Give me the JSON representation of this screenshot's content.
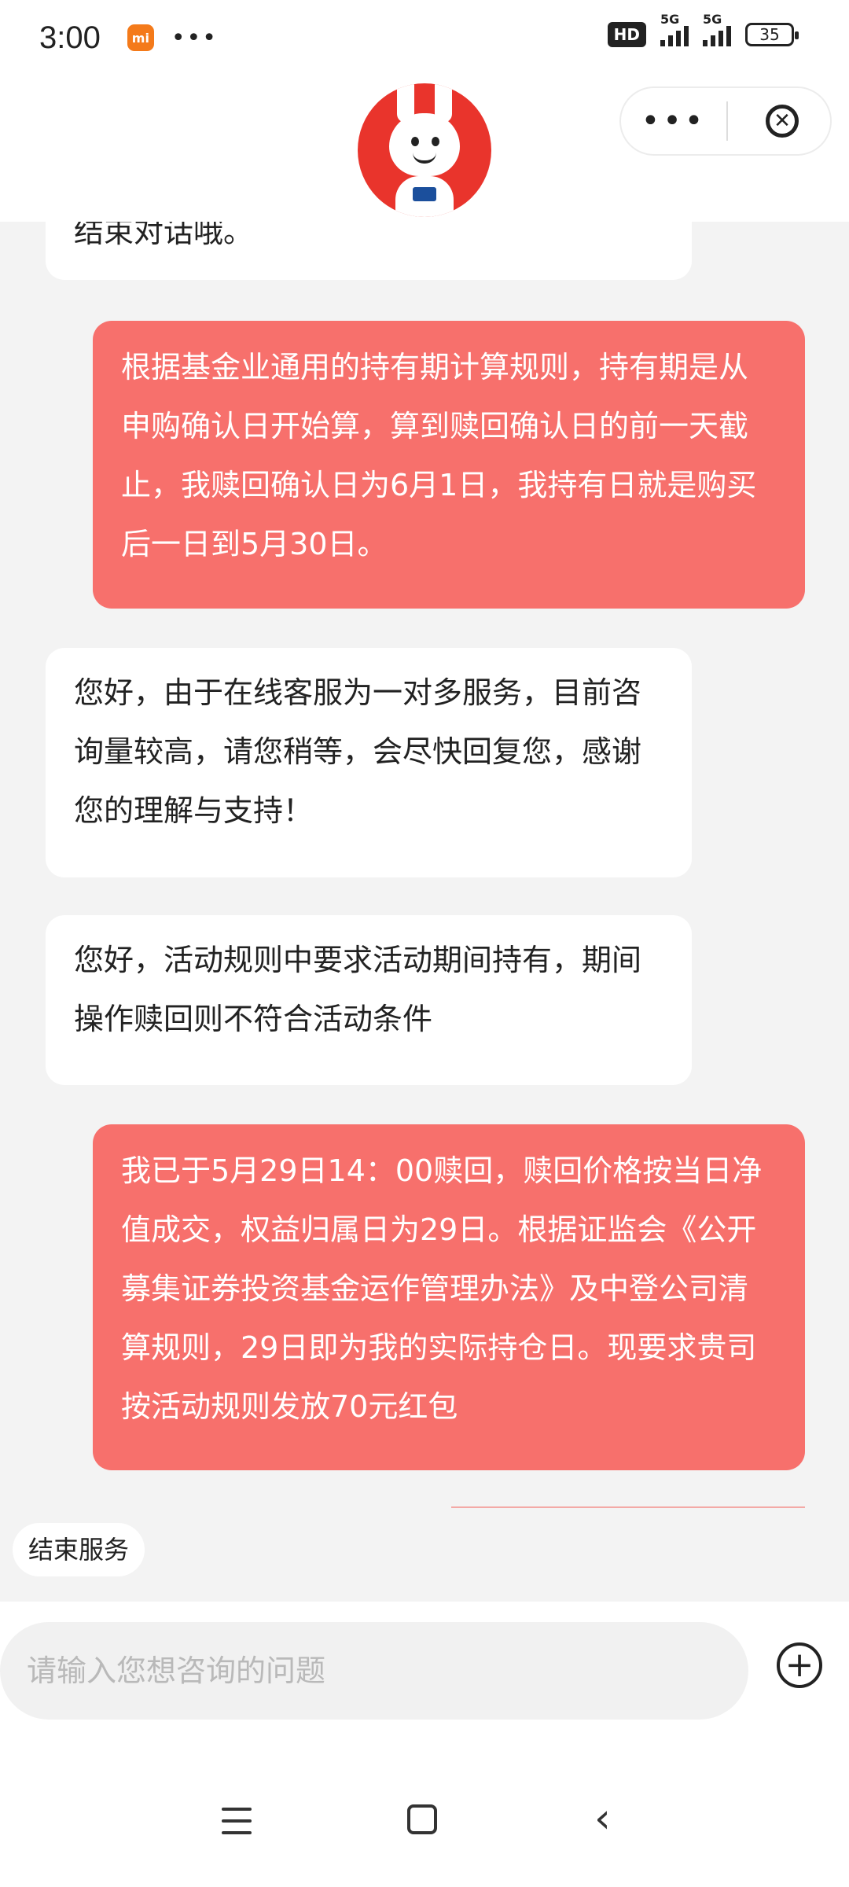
{
  "status_bar": {
    "time": "3:00",
    "mi_badge": "mi",
    "dots": "•••",
    "hd_badge": "HD",
    "network_1": "5G",
    "network_2": "5G",
    "battery": "35"
  },
  "header": {
    "more_label": "•••",
    "close_label": "✕"
  },
  "chat": {
    "messages": [
      {
        "role": "agent",
        "text": "结束对话哦。"
      },
      {
        "role": "user",
        "text": "根据基金业通用的持有期计算规则，持有期是从申购确认日开始算，算到赎回确认日的前一天截止，我赎回确认日为6月1日，我持有日就是购买后一日到5月30日。"
      },
      {
        "role": "agent",
        "text": "您好，由于在线客服为一对多服务，目前咨询量较高，请您稍等，会尽快回复您，感谢您的理解与支持！"
      },
      {
        "role": "agent",
        "text": "您好，活动规则中要求活动期间持有，期间操作赎回则不符合活动条件"
      },
      {
        "role": "user",
        "text": "我已于5月29日14：00赎回，赎回价格按当日净值成交，权益归属日为29日。根据证监会《公开募集证券投资基金运作管理办法》及中登公司清算规则，29日即为我的实际持仓日。现要求贵司按活动规则发放70元红包"
      }
    ]
  },
  "end_service_label": "结束服务",
  "input": {
    "placeholder": "请输入您想咨询的问题",
    "plus_label": "+"
  },
  "nav": {
    "back_label": "‹"
  },
  "colors": {
    "user_bubble": "#f7706c",
    "agent_bubble": "#ffffff",
    "chat_bg": "#f3f3f3"
  }
}
